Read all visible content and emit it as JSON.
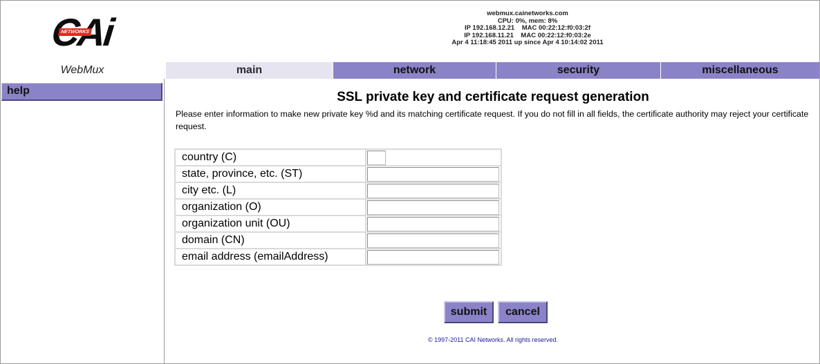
{
  "header": {
    "logo_text": "CAi",
    "logo_badge": "NETWORKS",
    "status_lines": [
      "webmux.cainetworks.com",
      "CPU: 0%, mem: 8%",
      "IP 192.168.12.21    MAC 00:22:12:f0:03:2f",
      "IP 192.168.11.21    MAC 00:22:12:f0:03:2e",
      "Apr 4 11:18:45 2011 up since Apr 4 10:14:02 2011"
    ]
  },
  "nav": {
    "app_name": "WebMux",
    "tabs": [
      {
        "label": "main",
        "active": true
      },
      {
        "label": "network",
        "active": false
      },
      {
        "label": "security",
        "active": false
      },
      {
        "label": "miscellaneous",
        "active": false
      }
    ]
  },
  "sidebar": {
    "items": [
      {
        "label": "help"
      }
    ]
  },
  "main": {
    "title": "SSL private key and certificate request generation",
    "intro": "Please enter information to make new private key %d and its matching certificate request. If you do not fill in all fields, the certificate authority may reject your certificate request.",
    "fields": [
      {
        "label": "country (C)",
        "value": ""
      },
      {
        "label": "state, province, etc. (ST)",
        "value": ""
      },
      {
        "label": "city etc. (L)",
        "value": ""
      },
      {
        "label": "organization (O)",
        "value": ""
      },
      {
        "label": "organization unit (OU)",
        "value": ""
      },
      {
        "label": "domain (CN)",
        "value": ""
      },
      {
        "label": "email address (emailAddress)",
        "value": ""
      }
    ],
    "submit_label": "submit",
    "cancel_label": "cancel"
  },
  "footer": {
    "copyright": "© 1997-2011 CAI Networks. All rights reserved."
  },
  "colors": {
    "tab_bg": "#8a83c8",
    "tab_active_bg": "#e6e4f0",
    "logo_badge": "#e3261d"
  }
}
